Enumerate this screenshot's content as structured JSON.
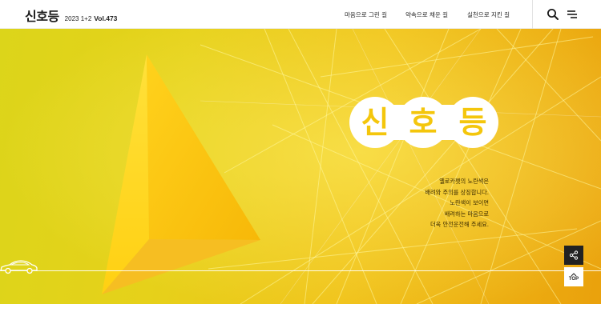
{
  "header": {
    "logo": "신호등",
    "issue_year": "2023 1+2",
    "volume": "Vol.473",
    "nav": [
      "마음으로 그린 길",
      "약속으로 채운 길",
      "실천으로 지킨 길"
    ],
    "icons": {
      "search": "search-icon",
      "menu": "menu-icon"
    }
  },
  "hero": {
    "title_chars": [
      "신",
      "호",
      "등"
    ],
    "description_lines": [
      "옐로카펫의 노란색은",
      "배려와 주의를 상징합니다.",
      "노란색이 보이면",
      "배려하는 마음으로",
      "더욱 안전운전해 주세요."
    ],
    "colors": {
      "accent": "#f4c60c",
      "background_start": "#dcd51a",
      "background_end": "#eaa10c"
    }
  },
  "floating": {
    "share_icon": "share-icon",
    "top_label": "TOP"
  }
}
